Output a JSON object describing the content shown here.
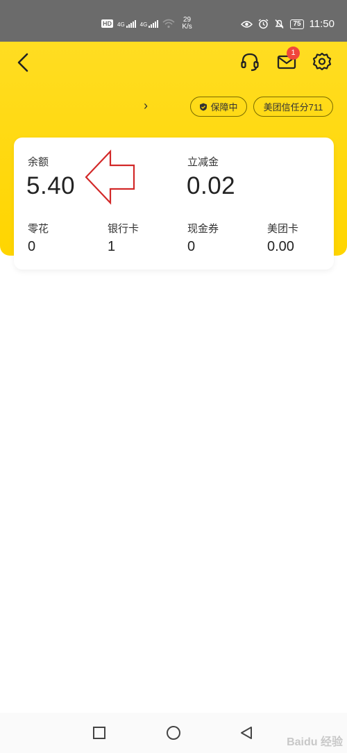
{
  "status_bar": {
    "hd": "HD",
    "net1": "4G",
    "net2": "4G",
    "speed_value": "29",
    "speed_unit": "K/s",
    "battery": "75",
    "time": "11:50"
  },
  "header": {
    "mail_badge": "1",
    "chevron": "›",
    "guard_label": "保障中",
    "credit_label": "美团信任分711"
  },
  "card": {
    "balance_label": "余额",
    "balance_value": "5.40",
    "discount_label": "立减金",
    "discount_value": "0.02",
    "items": [
      {
        "label": "零花",
        "value": "0"
      },
      {
        "label": "银行卡",
        "value": "1"
      },
      {
        "label": "现金券",
        "value": "0"
      },
      {
        "label": "美团卡",
        "value": "0.00"
      }
    ]
  },
  "colors": {
    "header_yellow": "#ffd500",
    "badge_red": "#f0463c",
    "annotation_arrow": "#d22828"
  },
  "icons": [
    "back-icon",
    "headset-icon",
    "mail-icon",
    "gear-icon",
    "shield-icon",
    "square-icon",
    "circle-icon",
    "triangle-back-icon"
  ],
  "watermark": "Baidu 经验"
}
